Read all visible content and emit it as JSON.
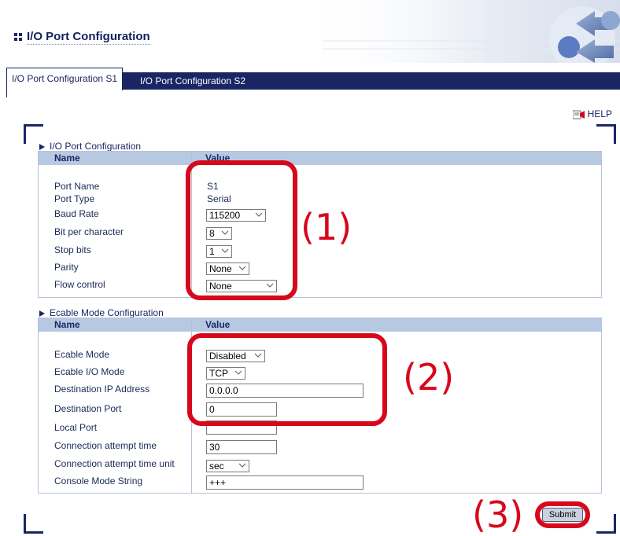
{
  "page": {
    "title": "I/O Port Configuration"
  },
  "tabs": [
    {
      "label": "I/O Port Configuration S1",
      "active": true
    },
    {
      "label": "I/O Port Configuration S2",
      "active": false
    }
  ],
  "help": {
    "label": "HELP"
  },
  "io_port_section": {
    "title": "I/O Port Configuration",
    "columns": [
      "Name",
      "Value"
    ],
    "port_name": {
      "label": "Port Name",
      "value": "S1"
    },
    "port_type": {
      "label": "Port Type",
      "value": "Serial"
    },
    "baud_rate": {
      "label": "Baud Rate",
      "value": "115200"
    },
    "bit_per_character": {
      "label": "Bit per character",
      "value": "8"
    },
    "stop_bits": {
      "label": "Stop bits",
      "value": "1"
    },
    "parity": {
      "label": "Parity",
      "value": "None"
    },
    "flow_control": {
      "label": "Flow control",
      "value": "None"
    }
  },
  "ecable_section": {
    "title": "Ecable Mode Configuration",
    "columns": [
      "Name",
      "Value"
    ],
    "ecable_mode": {
      "label": "Ecable Mode",
      "value": "Disabled"
    },
    "ecable_io_mode": {
      "label": "Ecable I/O Mode",
      "value": "TCP"
    },
    "destination_ip": {
      "label": "Destination IP Address",
      "value": "0.0.0.0"
    },
    "destination_port": {
      "label": "Destination Port",
      "value": "0"
    },
    "local_port": {
      "label": "Local Port",
      "value": ""
    },
    "connection_attempt_time": {
      "label": "Connection attempt time",
      "value": "30"
    },
    "connection_attempt_time_unit": {
      "label": "Connection attempt time unit",
      "value": "sec"
    },
    "console_mode_string": {
      "label": "Console Mode String",
      "value": "+++"
    }
  },
  "submit": {
    "label": "Submit"
  },
  "annotations": {
    "callout_1": "(1)",
    "callout_2": "(2)",
    "callout_3": "(3)"
  },
  "colors": {
    "navy": "#1a2664",
    "header_row": "#b7c9e2",
    "callout_red": "#d7081b"
  },
  "icons": {
    "title_icon": "grid-bullet-icon",
    "help_icon": "help-book-icon",
    "section_icon": "triangle-right-icon",
    "dropdown_icon": "chevron-down-icon"
  }
}
